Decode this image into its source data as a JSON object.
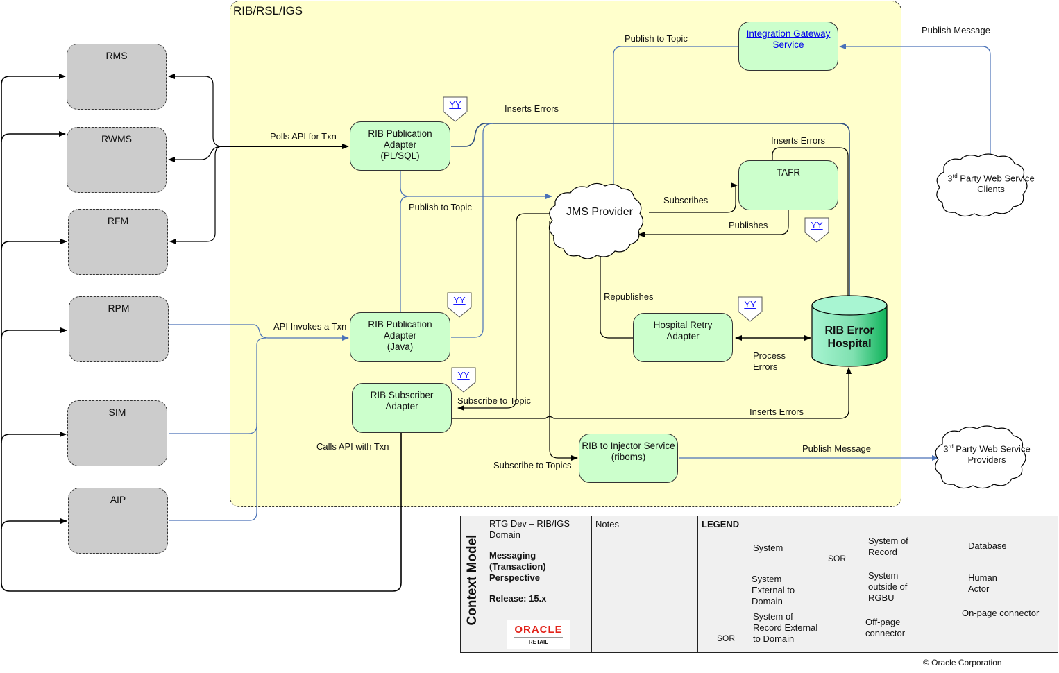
{
  "domain_box": {
    "title": "RIB/RSL/IGS"
  },
  "external_systems": [
    {
      "id": "rms",
      "label": "RMS"
    },
    {
      "id": "rwms",
      "label": "RWMS"
    },
    {
      "id": "rfm",
      "label": "RFM"
    },
    {
      "id": "rpm",
      "label": "RPM"
    },
    {
      "id": "sim",
      "label": "SIM"
    },
    {
      "id": "aip",
      "label": "AIP"
    }
  ],
  "systems": {
    "igs": {
      "line1": "Integration Gateway",
      "line2": "Service"
    },
    "pub_plsql": {
      "line1": "RIB Publication",
      "line2": "Adapter",
      "line3": "(PL/SQL)"
    },
    "pub_java": {
      "line1": "RIB Publication",
      "line2": "Adapter",
      "line3": "(Java)"
    },
    "subscriber": {
      "line1": "RIB Subscriber",
      "line2": "Adapter"
    },
    "tafr": {
      "line1": "TAFR"
    },
    "hospital_retry": {
      "line1": "Hospital Retry",
      "line2": "Adapter"
    },
    "injector": {
      "line1": "RIB to Injector Service",
      "line2": "(riboms)"
    }
  },
  "jms": {
    "label": "JMS Provider"
  },
  "database": {
    "line1": "RIB Error",
    "line2": "Hospital"
  },
  "clouds": {
    "clients": {
      "ord": "3",
      "sup": "rd",
      "line1": " Party Web Service",
      "line2": "Clients"
    },
    "providers": {
      "ord": "3",
      "sup": "rd",
      "line1": " Party Web Service",
      "line2": "Providers"
    }
  },
  "connector_label": "YY",
  "edge_labels": {
    "publish_topic_top": "Publish to Topic",
    "publish_message_top": "Publish Message",
    "inserts_errors_top": "Inserts Errors",
    "polls_api": "Polls API for Txn",
    "inserts_errors_tafr": "Inserts Errors",
    "subscribes": "Subscribes",
    "publish_to_topic_mid": "Publish to Topic",
    "publishes": "Publishes",
    "republishes": "Republishes",
    "api_invokes": "API Invokes a Txn",
    "process_errors_1": "Process",
    "process_errors_2": "Errors",
    "subscribe_to_topic": "Subscribe to Topic",
    "inserts_errors_bottom": "Inserts Errors",
    "calls_api": "Calls API with Txn",
    "subscribe_to_topics": "Subscribe to Topics",
    "publish_message_bottom": "Publish Message"
  },
  "title_block": {
    "vertical_title": "Context Model",
    "domain_line1": "RTG Dev – RIB/IGS",
    "domain_line2": "Domain",
    "perspective_1": "Messaging",
    "perspective_2": "(Transaction)",
    "perspective_3": "Perspective",
    "release": "Release:  15.x",
    "logo_brand": "ORACLE",
    "logo_sub": "RETAIL",
    "notes_label": "Notes",
    "legend_title": "LEGEND",
    "legend": {
      "system": "System",
      "sor_1": "System of",
      "sor_2": "Record",
      "sor_badge": "SOR",
      "database": "Database",
      "ext_1": "System",
      "ext_2": "External to",
      "ext_3": "Domain",
      "outside_1": "System",
      "outside_2": "outside of",
      "outside_3": "RGBU",
      "human_1": "Human",
      "human_2": "Actor",
      "sor_ext_1": "System of",
      "sor_ext_2": "Record External",
      "sor_ext_3": "to Domain",
      "offpage_1": "Off-page",
      "offpage_2": "connector",
      "onpage": "On-page connector"
    }
  },
  "copyright": "© Oracle Corporation",
  "colors": {
    "domain_fill": "#ffffcc",
    "system_fill": "#ccffcc",
    "external_fill": "#cccccc",
    "sor_fill": "#ccccff",
    "blue_line": "#4a72b8",
    "db_light": "#a8f5d2",
    "db_dark": "#0fb35a",
    "oracle_red": "#e2231a"
  }
}
